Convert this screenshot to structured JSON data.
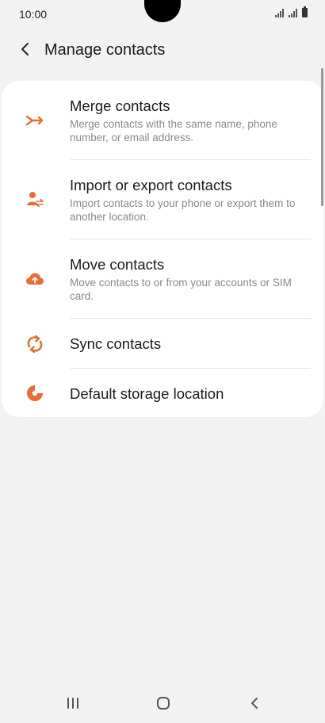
{
  "status_bar": {
    "time": "10:00"
  },
  "header": {
    "title": "Manage contacts"
  },
  "menu": {
    "items": [
      {
        "title": "Merge contacts",
        "description": "Merge contacts with the same name, phone number, or email address.",
        "icon": "merge-icon"
      },
      {
        "title": "Import or export contacts",
        "description": "Import contacts to your phone or export them to another location.",
        "icon": "import-export-icon"
      },
      {
        "title": "Move contacts",
        "description": "Move contacts to or from your accounts or SIM card.",
        "icon": "cloud-upload-icon"
      },
      {
        "title": "Sync contacts",
        "icon": "sync-icon"
      },
      {
        "title": "Default storage location",
        "icon": "storage-pie-icon"
      }
    ]
  },
  "colors": {
    "accent": "#e86f33",
    "background": "#f2f2f2",
    "card": "#ffffff"
  }
}
